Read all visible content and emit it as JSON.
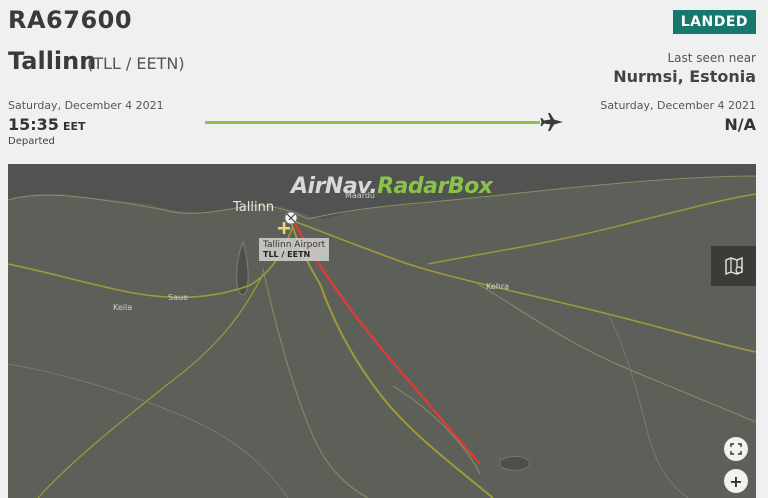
{
  "flight": {
    "id": "RA67600",
    "status": "LANDED"
  },
  "origin": {
    "city": "Tallinn",
    "codes": "(TLL / EETN)"
  },
  "last_seen": {
    "label": "Last seen near",
    "place": "Nurmsi, Estonia"
  },
  "departure": {
    "date": "Saturday, December 4 2021",
    "time": "15:35",
    "tz": "EET",
    "status": "Departed"
  },
  "arrival": {
    "date": "Saturday, December 4 2021",
    "time": "N/A"
  },
  "map": {
    "brand_left": "AirNav.",
    "brand_right": "RadarBox",
    "city_labels": [
      "Tallinn",
      "Saue",
      "Keila",
      "Kehra",
      "Maardu"
    ],
    "airport_tag": {
      "name": "Tallinn Airport",
      "codes": "TLL / EETN"
    },
    "track_color": "#e53935",
    "progress_color": "#8bc34a",
    "badge_color": "#17786d"
  },
  "icons": {
    "plane": "plane-icon",
    "layers": "map-layers-icon",
    "fullscreen": "fullscreen-icon",
    "zoom_in": "plus"
  },
  "controls": {
    "zoom_in_label": "+"
  }
}
